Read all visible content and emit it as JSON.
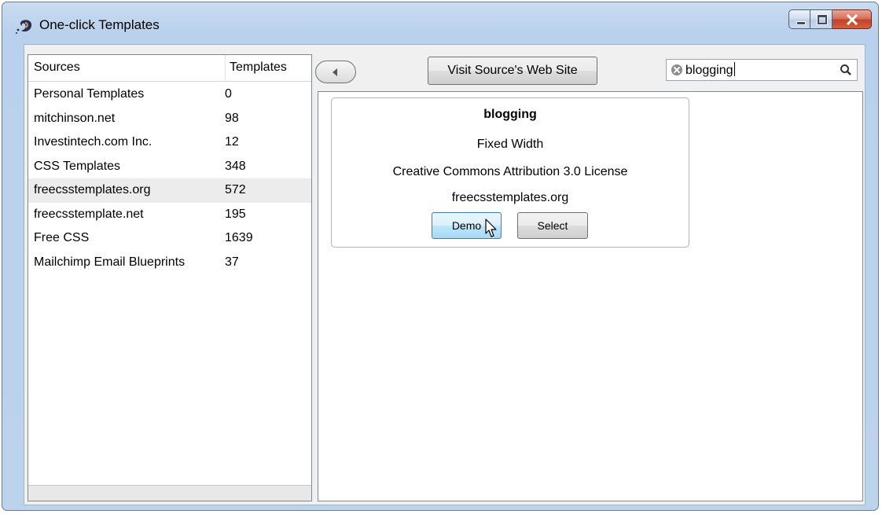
{
  "window": {
    "title": "One-click Templates"
  },
  "sources": {
    "column_headers": {
      "source": "Sources",
      "templates": "Templates"
    },
    "rows": [
      {
        "name": "Personal Templates",
        "count": "0"
      },
      {
        "name": "mitchinson.net",
        "count": "98"
      },
      {
        "name": "Investintech.com Inc.",
        "count": "12"
      },
      {
        "name": "CSS Templates",
        "count": "348"
      },
      {
        "name": "freecsstemplates.org",
        "count": "572",
        "selected": true
      },
      {
        "name": "freecsstemplate.net",
        "count": "195"
      },
      {
        "name": "Free CSS",
        "count": "1639"
      },
      {
        "name": "Mailchimp Email Blueprints",
        "count": "37"
      }
    ]
  },
  "toolbar": {
    "visit_label": "Visit Source's Web Site",
    "search_value": "blogging"
  },
  "template_card": {
    "title": "blogging",
    "layout": "Fixed Width",
    "license": "Creative Commons Attribution 3.0 License",
    "source": "freecsstemplates.org",
    "demo_label": "Demo",
    "select_label": "Select"
  },
  "icons": {
    "app": "swirl-logo-icon",
    "back": "back-arrow-icon",
    "clear": "clear-search-icon",
    "search": "search-icon",
    "cursor": "mouse-pointer-icon"
  },
  "colors": {
    "frame": "#b9d1ec",
    "close": "#c2412a",
    "selected_row": "#ececec",
    "demo_hover": "#bee6fd"
  }
}
